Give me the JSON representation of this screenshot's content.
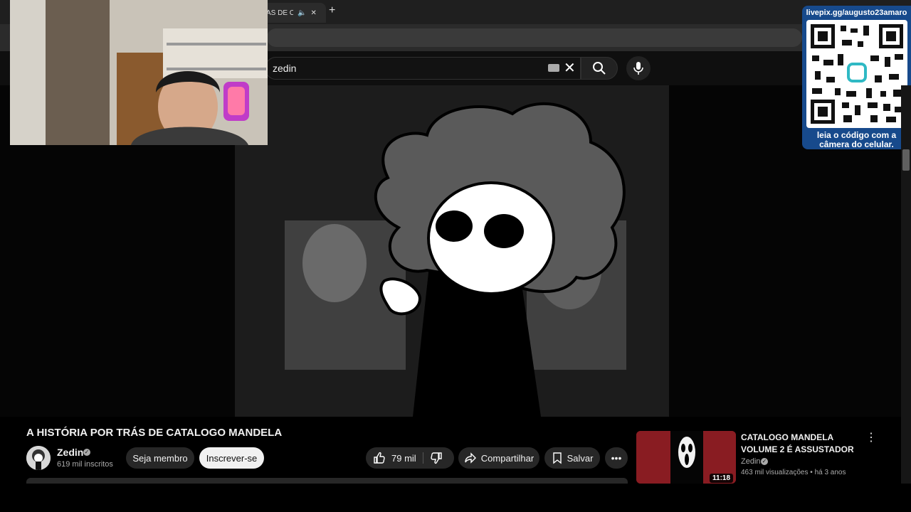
{
  "browser": {
    "tab_title": "ÁS DE C",
    "new_tab": "+"
  },
  "search": {
    "query": "zedin"
  },
  "qr_panel": {
    "url": "livepix.gg/augusto23amaro",
    "caption_line1": "leia o código com a",
    "caption_line2": "câmera do celular."
  },
  "video": {
    "title": "A HISTÓRIA POR TRÁS DE CATALOGO MANDELA",
    "channel": "Zedin",
    "subscribers": "619 mil inscritos",
    "member_label": "Seja membro",
    "subscribe_label": "Inscrever-se",
    "likes": "79 mil",
    "share_label": "Compartilhar",
    "save_label": "Salvar",
    "more_label": "•••"
  },
  "recommended": [
    {
      "title": "CATALOGO MANDELA VOLUME 2 É ASSUSTADOR",
      "channel": "Zedin",
      "views": "463 mil visualizações",
      "age": "há 3 anos",
      "duration": "11:18"
    }
  ],
  "colors": {
    "page_bg": "#0f0f0f",
    "button_bg": "#272727",
    "subscribe_bg": "#f1f1f1",
    "qr_panel_bg": "#174a8c"
  },
  "icons": [
    "keyboard-icon",
    "clear-icon",
    "search-icon",
    "mic-icon",
    "more-vert-icon",
    "like-icon",
    "dislike-icon",
    "share-icon",
    "save-icon",
    "verified-icon",
    "audio-icon",
    "tab-close-icon"
  ]
}
